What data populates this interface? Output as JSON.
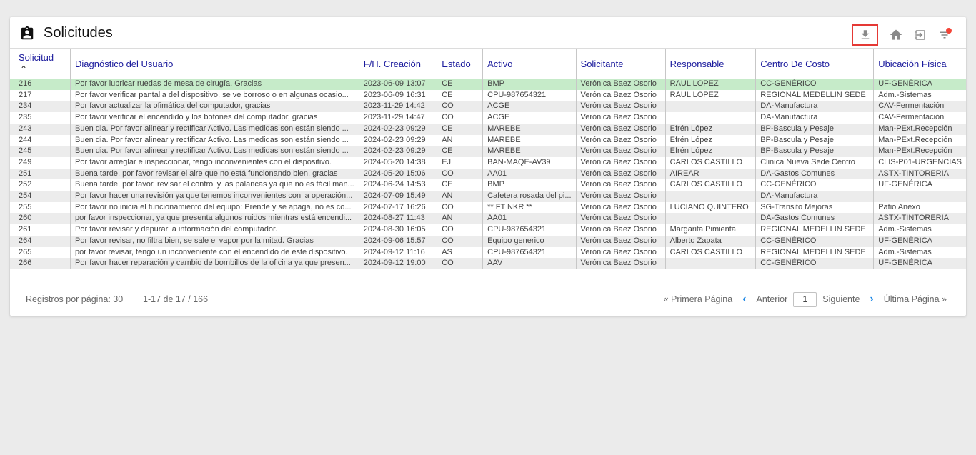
{
  "header": {
    "title": "Solicitudes",
    "icons": [
      "badge-icon",
      "download-icon",
      "home-icon",
      "exit-icon",
      "filter-icon"
    ]
  },
  "table": {
    "columns": [
      {
        "label": "Solicitud",
        "sorted": "asc"
      },
      {
        "label": "Diagnóstico del Usuario"
      },
      {
        "label": "F/H. Creación"
      },
      {
        "label": "Estado"
      },
      {
        "label": "Activo"
      },
      {
        "label": "Solicitante"
      },
      {
        "label": "Responsable"
      },
      {
        "label": "Centro De Costo"
      },
      {
        "label": "Ubicación Física"
      }
    ],
    "sort_indicator": "^",
    "selected_row": 0,
    "rows": [
      [
        "216",
        "Por favor lubricar ruedas de mesa de cirugía. Gracias",
        "2023-06-09 13:07",
        "CE",
        "BMP",
        "Verónica Baez Osorio",
        "RAUL LOPEZ",
        "CC-GENÉRICO",
        "UF-GENÉRICA"
      ],
      [
        "217",
        "Por favor verificar pantalla del dispositivo, se ve borroso o en algunas ocasio...",
        "2023-06-09 16:31",
        "CE",
        "CPU-987654321",
        "Verónica Baez Osorio",
        "RAUL LOPEZ",
        "REGIONAL MEDELLIN SEDE",
        "Adm.-Sistemas"
      ],
      [
        "234",
        "Por favor actualizar la ofimática del computador, gracias",
        "2023-11-29 14:42",
        "CO",
        "ACGE",
        "Verónica Baez Osorio",
        "",
        "DA-Manufactura",
        "CAV-Fermentación"
      ],
      [
        "235",
        "Por favor verificar el encendido y los botones del computador, gracias",
        "2023-11-29 14:47",
        "CO",
        "ACGE",
        "Verónica Baez Osorio",
        "",
        "DA-Manufactura",
        "CAV-Fermentación"
      ],
      [
        "243",
        "Buen dia. Por favor alinear y rectificar Activo. Las medidas son están siendo ...",
        "2024-02-23 09:29",
        "CE",
        "MAREBE",
        "Verónica Baez Osorio",
        "Efrén López",
        "BP-Bascula y Pesaje",
        "Man-PExt.Recepción"
      ],
      [
        "244",
        "Buen dia. Por favor alinear y rectificar Activo. Las medidas son están siendo ...",
        "2024-02-23 09:29",
        "AN",
        "MAREBE",
        "Verónica Baez Osorio",
        "Efrén López",
        "BP-Bascula y Pesaje",
        "Man-PExt.Recepción"
      ],
      [
        "245",
        "Buen dia. Por favor alinear y rectificar Activo. Las medidas son están siendo ...",
        "2024-02-23 09:29",
        "CE",
        "MAREBE",
        "Verónica Baez Osorio",
        "Efrén López",
        "BP-Bascula y Pesaje",
        "Man-PExt.Recepción"
      ],
      [
        "249",
        "Por favor arreglar e inspeccionar, tengo inconvenientes con el dispositivo.",
        "2024-05-20 14:38",
        "EJ",
        "BAN-MAQE-AV39",
        "Verónica Baez Osorio",
        "CARLOS CASTILLO",
        "Clinica Nueva Sede Centro",
        "CLIS-P01-URGENCIAS"
      ],
      [
        "251",
        "Buena tarde, por favor revisar el aire que no está funcionando bien, gracias",
        "2024-05-20 15:06",
        "CO",
        "AA01",
        "Verónica Baez Osorio",
        "AIREAR",
        "DA-Gastos Comunes",
        "ASTX-TINTORERIA"
      ],
      [
        "252",
        "Buena tarde, por favor, revisar el control y las palancas ya que no es fácil man...",
        "2024-06-24 14:53",
        "CE",
        "BMP",
        "Verónica Baez Osorio",
        "CARLOS CASTILLO",
        "CC-GENÉRICO",
        "UF-GENÉRICA"
      ],
      [
        "254",
        "Por favor hacer una revisión ya que tenemos inconvenientes con la operación...",
        "2024-07-09 15:49",
        "AN",
        "Cafetera rosada del pi...",
        "Verónica Baez Osorio",
        "",
        "DA-Manufactura",
        ""
      ],
      [
        "255",
        "Por favor no inicia el funcionamiento del equipo: Prende y se apaga, no es co...",
        "2024-07-17 16:26",
        "CO",
        "** FT NKR **",
        "Verónica Baez Osorio",
        "LUCIANO QUINTERO",
        "SG-Transito Mejoras",
        "Patio Anexo"
      ],
      [
        "260",
        "por favor inspeccionar, ya que presenta algunos ruidos mientras está encendi...",
        "2024-08-27 11:43",
        "AN",
        "AA01",
        "Verónica Baez Osorio",
        "",
        "DA-Gastos Comunes",
        "ASTX-TINTORERIA"
      ],
      [
        "261",
        "Por favor revisar y depurar la información del computador.",
        "2024-08-30 16:05",
        "CO",
        "CPU-987654321",
        "Verónica Baez Osorio",
        "Margarita Pimienta",
        "REGIONAL MEDELLIN SEDE",
        "Adm.-Sistemas"
      ],
      [
        "264",
        "Por favor revisar, no filtra bien, se sale el vapor por la mitad. Gracias",
        "2024-09-06 15:57",
        "CO",
        "Equipo generico",
        "Verónica Baez Osorio",
        "Alberto Zapata",
        "CC-GENÉRICO",
        "UF-GENÉRICA"
      ],
      [
        "265",
        "por favor revisar, tengo un inconveniente con el encendido de este dispositivo.",
        "2024-09-12 11:16",
        "AS",
        "CPU-987654321",
        "Verónica Baez Osorio",
        "CARLOS CASTILLO",
        "REGIONAL MEDELLIN SEDE",
        "Adm.-Sistemas"
      ],
      [
        "266",
        "Por favor hacer reparación y cambio de bombillos de la oficina ya que presen...",
        "2024-09-12 19:00",
        "CO",
        "AAV",
        "Verónica Baez Osorio",
        "",
        "CC-GENÉRICO",
        "UF-GENÉRICA"
      ]
    ]
  },
  "footer": {
    "per_page_label": "Registros por página: 30",
    "range_label": "1-17 de 17 / 166",
    "first_page": "« Primera Página",
    "prev": "Anterior",
    "current_page": "1",
    "next": "Siguiente",
    "last_page": "Última Página »"
  },
  "colors": {
    "header_text": "#1a1a9c",
    "selected_row": "#c6ebc9",
    "accent": "#1e88e5",
    "highlight_border": "#e53935",
    "badge_dot": "#f44336"
  }
}
